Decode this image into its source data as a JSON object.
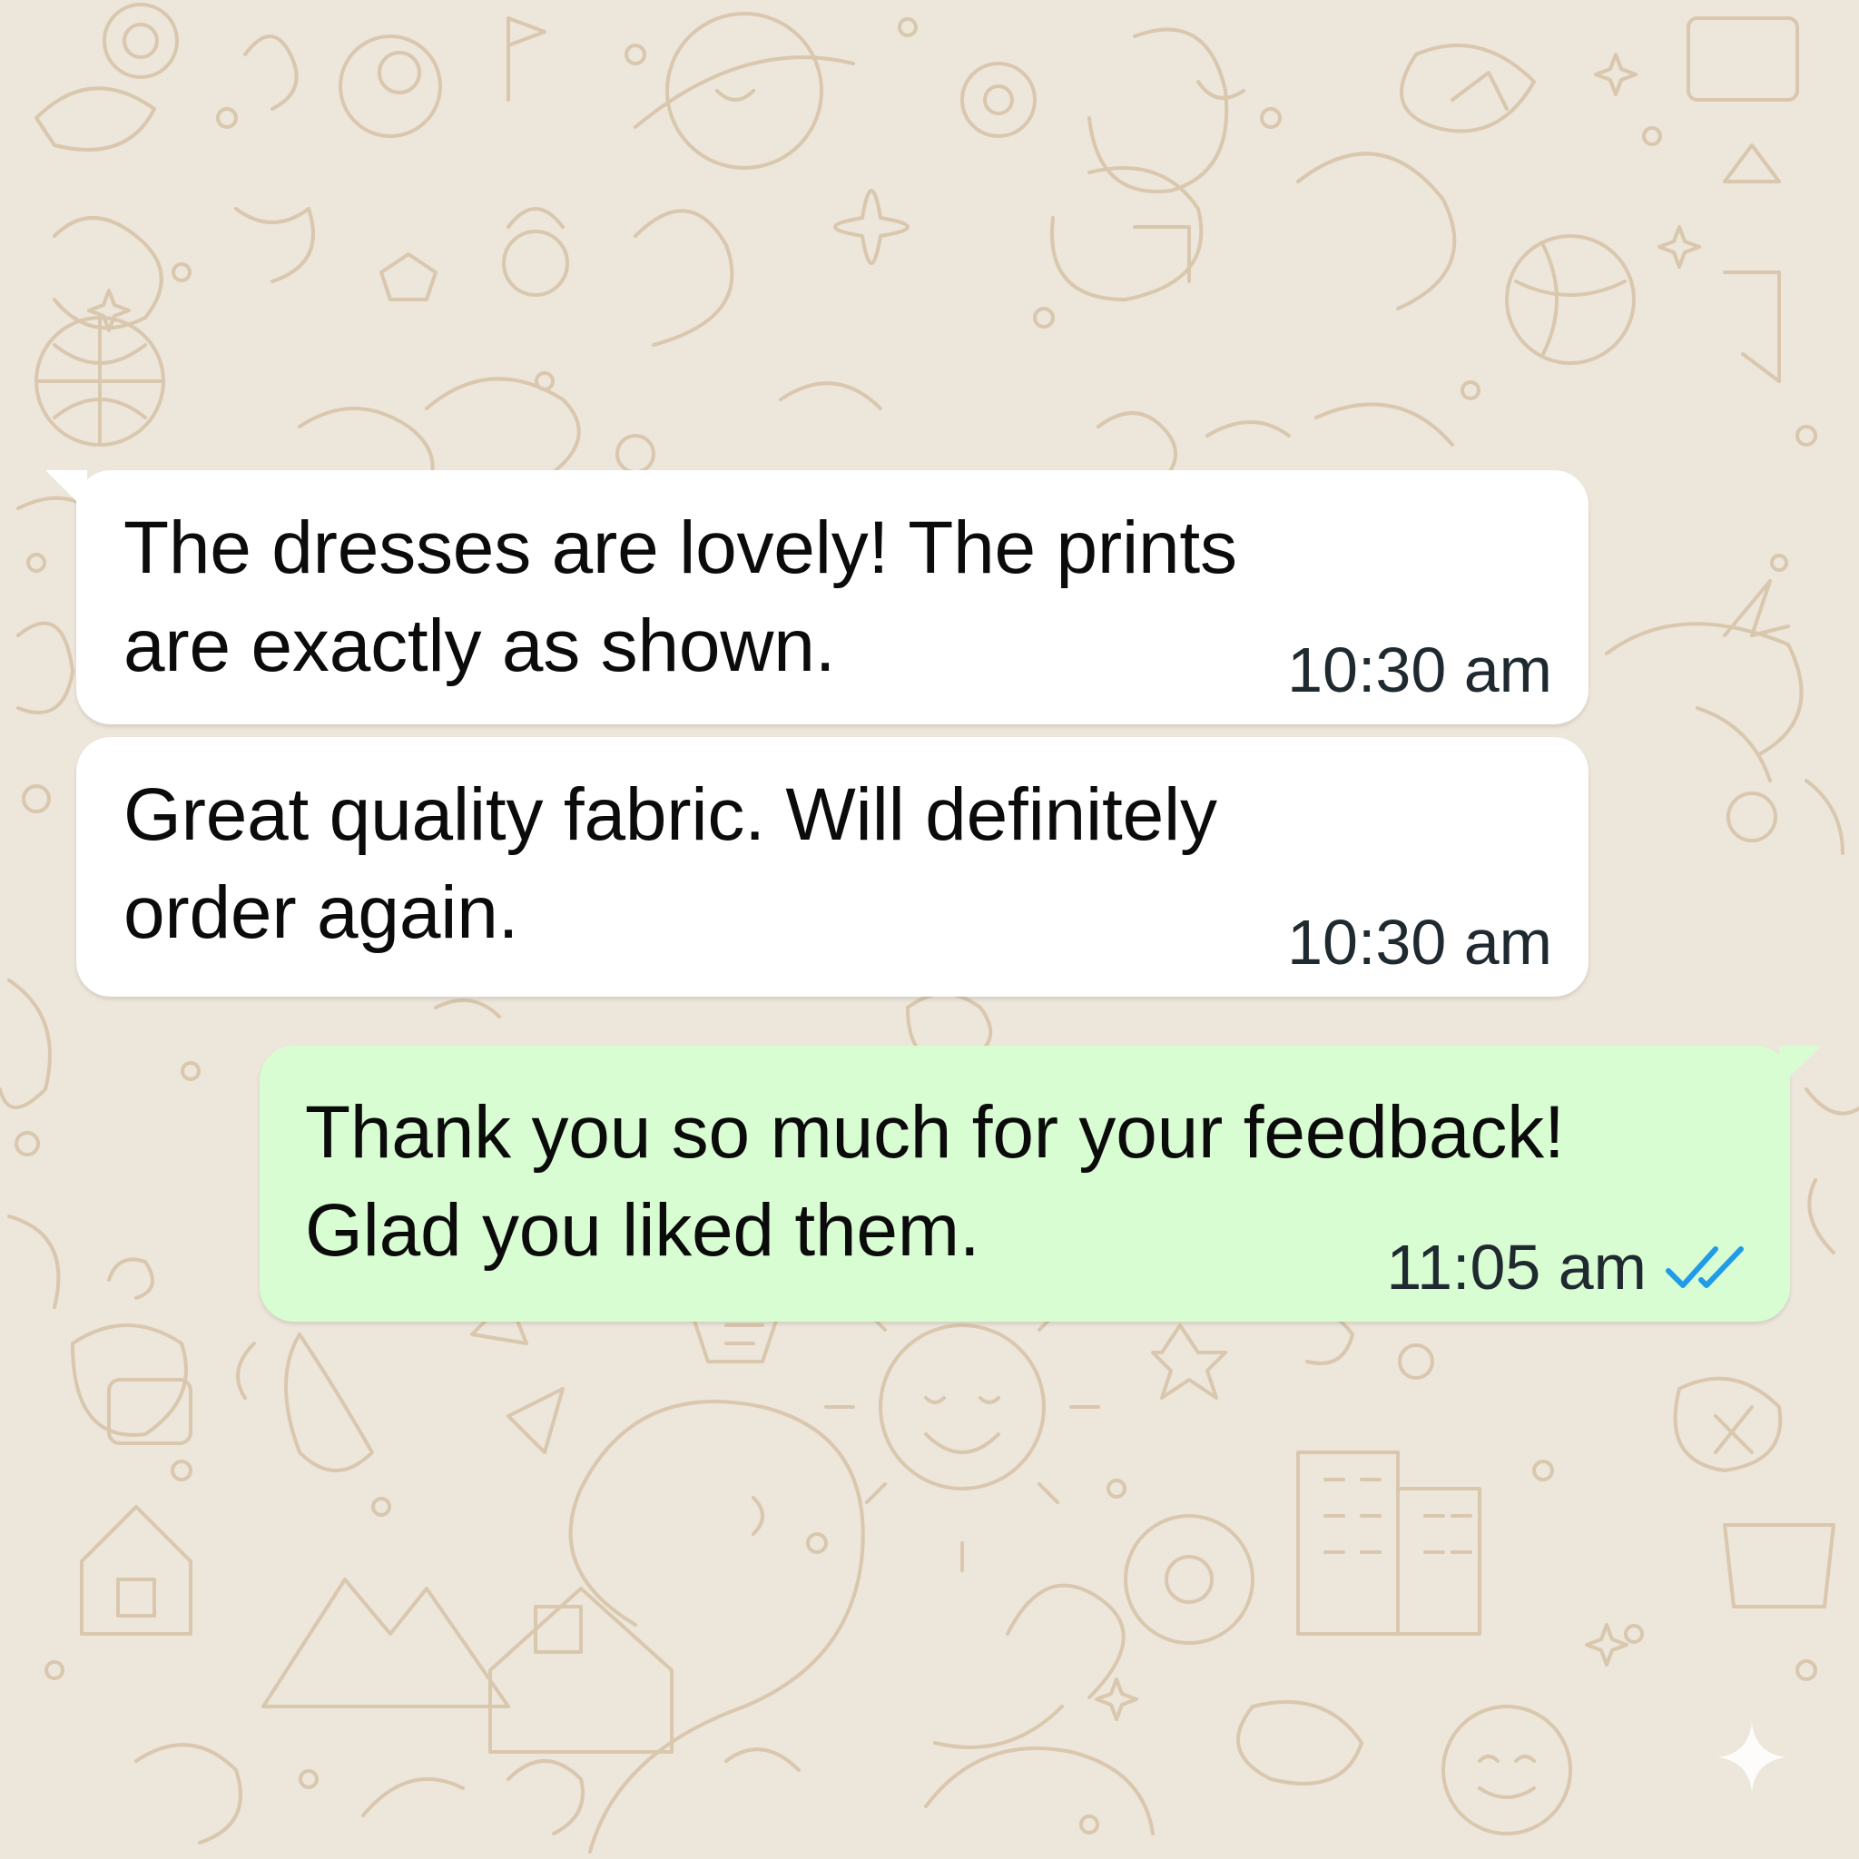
{
  "theme": {
    "background": "#ede6da",
    "doodle_stroke": "#d9c7ae",
    "incoming_bubble": "#ffffff",
    "outgoing_bubble": "#d9fdd3",
    "read_tick_color": "#1f9be8"
  },
  "messages": [
    {
      "direction": "incoming",
      "text": "The dresses are lovely! The prints\nare exactly as shown.",
      "time": "10:30 am"
    },
    {
      "direction": "incoming",
      "text": "Great quality fabric. Will definitely\norder again.",
      "time": "10:30 am"
    },
    {
      "direction": "outgoing",
      "text": "Thank you so much for your feedback!\nGlad you liked them.",
      "time": "11:05 am",
      "status_icon": "double-check-icon"
    }
  ],
  "icons": {
    "corner_mark": "sparkle-icon"
  }
}
